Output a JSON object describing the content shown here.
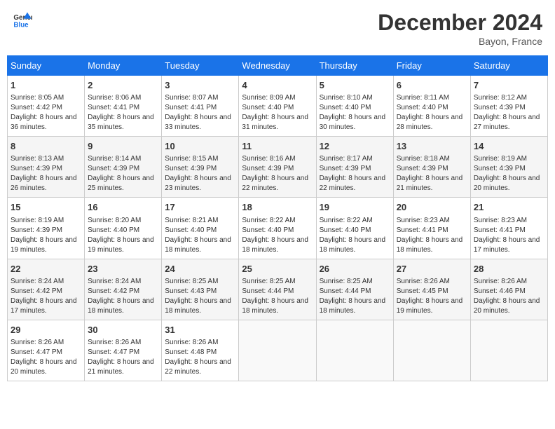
{
  "header": {
    "logo_text_general": "General",
    "logo_text_blue": "Blue",
    "month": "December 2024",
    "location": "Bayon, France"
  },
  "days_of_week": [
    "Sunday",
    "Monday",
    "Tuesday",
    "Wednesday",
    "Thursday",
    "Friday",
    "Saturday"
  ],
  "weeks": [
    [
      {
        "day": "1",
        "sunrise": "8:05 AM",
        "sunset": "4:42 PM",
        "daylight": "8 hours and 36 minutes."
      },
      {
        "day": "2",
        "sunrise": "8:06 AM",
        "sunset": "4:41 PM",
        "daylight": "8 hours and 35 minutes."
      },
      {
        "day": "3",
        "sunrise": "8:07 AM",
        "sunset": "4:41 PM",
        "daylight": "8 hours and 33 minutes."
      },
      {
        "day": "4",
        "sunrise": "8:09 AM",
        "sunset": "4:40 PM",
        "daylight": "8 hours and 31 minutes."
      },
      {
        "day": "5",
        "sunrise": "8:10 AM",
        "sunset": "4:40 PM",
        "daylight": "8 hours and 30 minutes."
      },
      {
        "day": "6",
        "sunrise": "8:11 AM",
        "sunset": "4:40 PM",
        "daylight": "8 hours and 28 minutes."
      },
      {
        "day": "7",
        "sunrise": "8:12 AM",
        "sunset": "4:39 PM",
        "daylight": "8 hours and 27 minutes."
      }
    ],
    [
      {
        "day": "8",
        "sunrise": "8:13 AM",
        "sunset": "4:39 PM",
        "daylight": "8 hours and 26 minutes."
      },
      {
        "day": "9",
        "sunrise": "8:14 AM",
        "sunset": "4:39 PM",
        "daylight": "8 hours and 25 minutes."
      },
      {
        "day": "10",
        "sunrise": "8:15 AM",
        "sunset": "4:39 PM",
        "daylight": "8 hours and 23 minutes."
      },
      {
        "day": "11",
        "sunrise": "8:16 AM",
        "sunset": "4:39 PM",
        "daylight": "8 hours and 22 minutes."
      },
      {
        "day": "12",
        "sunrise": "8:17 AM",
        "sunset": "4:39 PM",
        "daylight": "8 hours and 22 minutes."
      },
      {
        "day": "13",
        "sunrise": "8:18 AM",
        "sunset": "4:39 PM",
        "daylight": "8 hours and 21 minutes."
      },
      {
        "day": "14",
        "sunrise": "8:19 AM",
        "sunset": "4:39 PM",
        "daylight": "8 hours and 20 minutes."
      }
    ],
    [
      {
        "day": "15",
        "sunrise": "8:19 AM",
        "sunset": "4:39 PM",
        "daylight": "8 hours and 19 minutes."
      },
      {
        "day": "16",
        "sunrise": "8:20 AM",
        "sunset": "4:40 PM",
        "daylight": "8 hours and 19 minutes."
      },
      {
        "day": "17",
        "sunrise": "8:21 AM",
        "sunset": "4:40 PM",
        "daylight": "8 hours and 18 minutes."
      },
      {
        "day": "18",
        "sunrise": "8:22 AM",
        "sunset": "4:40 PM",
        "daylight": "8 hours and 18 minutes."
      },
      {
        "day": "19",
        "sunrise": "8:22 AM",
        "sunset": "4:40 PM",
        "daylight": "8 hours and 18 minutes."
      },
      {
        "day": "20",
        "sunrise": "8:23 AM",
        "sunset": "4:41 PM",
        "daylight": "8 hours and 18 minutes."
      },
      {
        "day": "21",
        "sunrise": "8:23 AM",
        "sunset": "4:41 PM",
        "daylight": "8 hours and 17 minutes."
      }
    ],
    [
      {
        "day": "22",
        "sunrise": "8:24 AM",
        "sunset": "4:42 PM",
        "daylight": "8 hours and 17 minutes."
      },
      {
        "day": "23",
        "sunrise": "8:24 AM",
        "sunset": "4:42 PM",
        "daylight": "8 hours and 18 minutes."
      },
      {
        "day": "24",
        "sunrise": "8:25 AM",
        "sunset": "4:43 PM",
        "daylight": "8 hours and 18 minutes."
      },
      {
        "day": "25",
        "sunrise": "8:25 AM",
        "sunset": "4:44 PM",
        "daylight": "8 hours and 18 minutes."
      },
      {
        "day": "26",
        "sunrise": "8:25 AM",
        "sunset": "4:44 PM",
        "daylight": "8 hours and 18 minutes."
      },
      {
        "day": "27",
        "sunrise": "8:26 AM",
        "sunset": "4:45 PM",
        "daylight": "8 hours and 19 minutes."
      },
      {
        "day": "28",
        "sunrise": "8:26 AM",
        "sunset": "4:46 PM",
        "daylight": "8 hours and 20 minutes."
      }
    ],
    [
      {
        "day": "29",
        "sunrise": "8:26 AM",
        "sunset": "4:47 PM",
        "daylight": "8 hours and 20 minutes."
      },
      {
        "day": "30",
        "sunrise": "8:26 AM",
        "sunset": "4:47 PM",
        "daylight": "8 hours and 21 minutes."
      },
      {
        "day": "31",
        "sunrise": "8:26 AM",
        "sunset": "4:48 PM",
        "daylight": "8 hours and 22 minutes."
      },
      null,
      null,
      null,
      null
    ]
  ],
  "labels": {
    "sunrise": "Sunrise: ",
    "sunset": "Sunset: ",
    "daylight": "Daylight: "
  }
}
